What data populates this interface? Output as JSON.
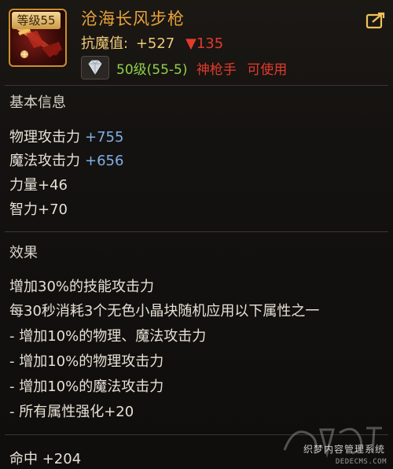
{
  "item": {
    "level_tag": "等级55",
    "name": "沧海长风步枪",
    "resist_label": "抗魔值:",
    "resist_value": "+527",
    "resist_down": "▼135",
    "requirement_level": "50级(55-5)",
    "requirement_class": "神枪手",
    "requirement_usable": "可使用"
  },
  "basic_info": {
    "title": "基本信息",
    "stats": [
      {
        "label": "物理攻击力",
        "value": "+755"
      },
      {
        "label": "魔法攻击力",
        "value": "+656"
      },
      {
        "label": "力量+46"
      },
      {
        "label": "智力+70"
      }
    ]
  },
  "effects": {
    "title": "效果",
    "lines": [
      "增加30%的技能攻击力",
      "每30秒消耗3个无色小晶块随机应用以下属性之一",
      "- 增加10%的物理、魔法攻击力",
      "- 增加10%的物理攻击力",
      "- 增加10%的魔法攻击力",
      "- 所有属性强化+20"
    ]
  },
  "footer": {
    "hit": "命中 +204"
  },
  "watermark": {
    "site": "织梦内容管理系统",
    "url": "DEDECMS.COM"
  },
  "colors": {
    "name": "#e8a23a",
    "resist": "#f0c977",
    "down": "#e23a2d",
    "level_req": "#8fd14a",
    "stat_value": "#7fb0e6"
  },
  "icons": {
    "weapon": "rifle-icon",
    "gem": "diamond-icon",
    "compare": "compare-icon"
  }
}
